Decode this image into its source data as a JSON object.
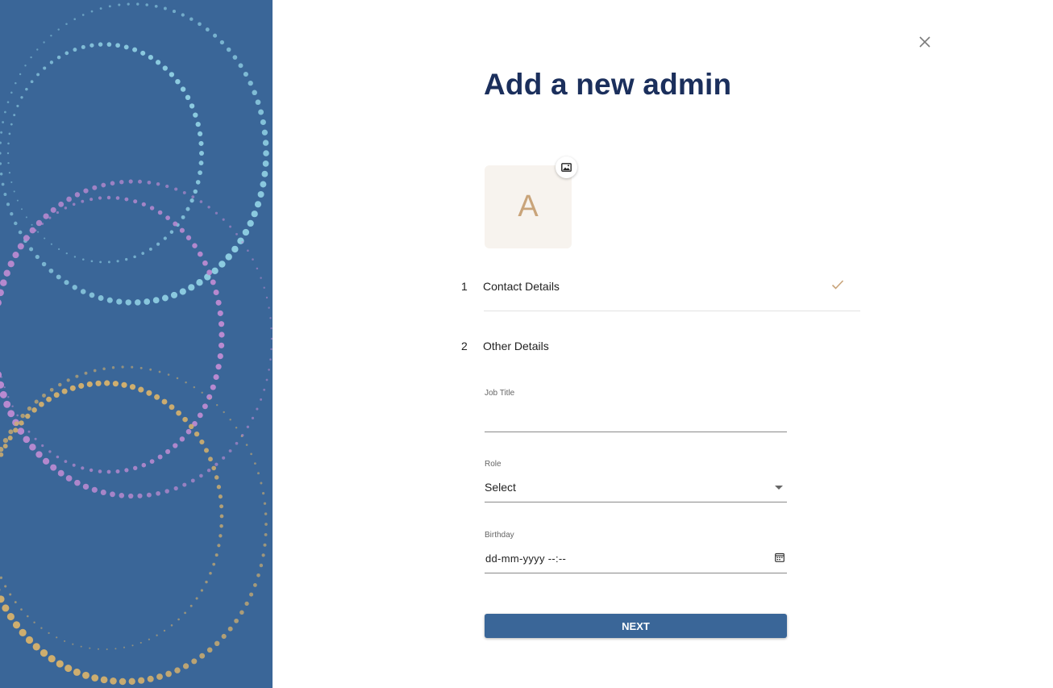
{
  "dialog": {
    "title": "Add a new admin",
    "close_icon": "close-icon"
  },
  "avatar": {
    "initial": "A",
    "upload_icon": "image-icon"
  },
  "steps": [
    {
      "number": "1",
      "label": "Contact Details",
      "status_icon": "check-icon",
      "completed": true
    },
    {
      "number": "2",
      "label": "Other Details",
      "completed": false
    }
  ],
  "form": {
    "job_title": {
      "label": "Job Title",
      "value": ""
    },
    "role": {
      "label": "Role",
      "value": "Select"
    },
    "birthday": {
      "label": "Birthday",
      "value": "dd-mm-yyyy  --:--",
      "icon": "calendar-icon"
    }
  },
  "actions": {
    "next_label": "NEXT"
  },
  "colors": {
    "sidebar": "#3a6698",
    "title": "#1b2f5c",
    "accent": "#c9a47a",
    "primary_button": "#3a6698",
    "dots_teal": "#8ccbe0",
    "dots_purple": "#b98ad0",
    "dots_gold": "#cfae6e"
  }
}
